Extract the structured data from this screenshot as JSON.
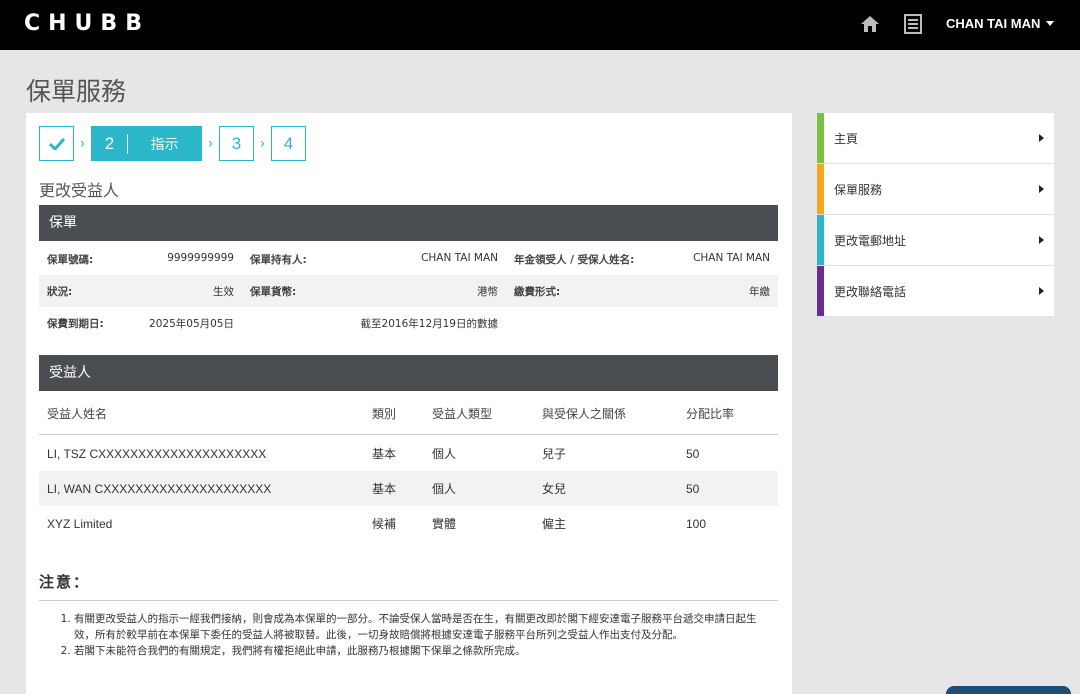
{
  "header": {
    "logo": "CHUBB",
    "user_name": "CHAN TAI MAN",
    "home_icon": "home-icon",
    "document_icon": "document-icon"
  },
  "page_title": "保單服務",
  "steps": {
    "step1_state": "done",
    "step2_number": "2",
    "step2_label": "指示",
    "step3_number": "3",
    "step4_number": "4"
  },
  "section_title": "更改受益人",
  "policy": {
    "bar_title": "保單",
    "rows": [
      [
        {
          "key": "保單號碼:",
          "value": "9999999999"
        },
        {
          "key": "保單持有人:",
          "value": "CHAN TAI MAN"
        },
        {
          "key": "年金領受人 / 受保人姓名:",
          "value": "CHAN TAI MAN"
        }
      ],
      [
        {
          "key": "狀況:",
          "value": "生效"
        },
        {
          "key": "保單貨幣:",
          "value": "港幣"
        },
        {
          "key": "繳費形式:",
          "value": "年繳"
        }
      ],
      [
        {
          "key": "保費到期日:",
          "value": "2025年05月05日"
        },
        {
          "key": "",
          "value": "截至2016年12月19日的數據"
        },
        {
          "key": "",
          "value": ""
        }
      ]
    ]
  },
  "beneficiaries": {
    "bar_title": "受益人",
    "columns": [
      "受益人姓名",
      "類別",
      "受益人類型",
      "與受保人之關係",
      "分配比率"
    ],
    "rows": [
      [
        "LI, TSZ CXXXXXXXXXXXXXXXXXXXXX",
        "基本",
        "個人",
        "兒子",
        "50"
      ],
      [
        "LI, WAN CXXXXXXXXXXXXXXXXXXXXX",
        "基本",
        "個人",
        "女兒",
        "50"
      ],
      [
        "XYZ Limited",
        "候補",
        "實體",
        "僱主",
        "100"
      ]
    ]
  },
  "notes": {
    "title": "注意：",
    "items": [
      "有關更改受益人的指示一經我們接納，則會成為本保單的一部分。不論受保人當時是否在生，有關更改即於閣下經安達電子服務平台遞交申請日起生效，所有於較早前在本保單下委任的受益人將被取替。此後，一切身故賠償將根據安達電子服務平台所列之受益人作出支付及分配。",
      "若閣下未能符合我們的有關規定，我們將有權拒絕此申請，此服務乃根據閣下保單之條款所完成。"
    ]
  },
  "side_menu": [
    {
      "label": "主頁",
      "color": "#7ac143"
    },
    {
      "label": "保單服務",
      "color": "#f5a623"
    },
    {
      "label": "更改電郵地址",
      "color": "#2bb7c9"
    },
    {
      "label": "更改聯絡電話",
      "color": "#6a2c91"
    }
  ]
}
